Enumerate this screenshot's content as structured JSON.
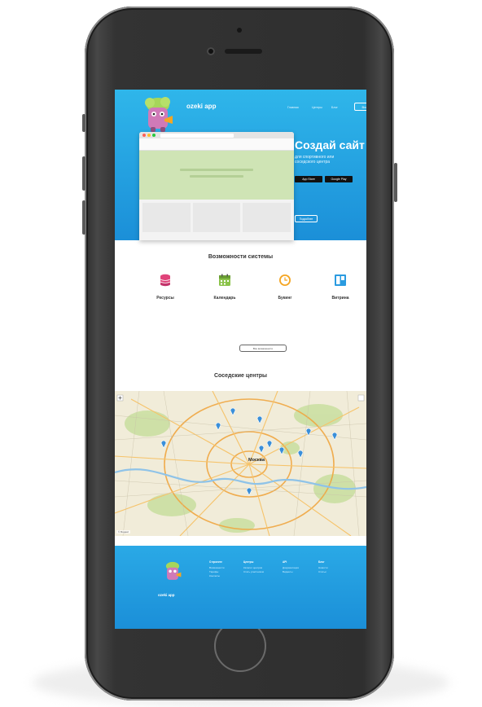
{
  "hero": {
    "brand": "ozeki app",
    "subtitle": "Создай сайт",
    "tagline": "для спортивного или\nсоседского центра",
    "store_buttons": [
      "App Store",
      "Google Play"
    ],
    "nav": [
      "Главная",
      "Центры",
      "Блог"
    ],
    "enter": "Вход",
    "more": "Подробнее"
  },
  "features": {
    "title": "Возможности системы",
    "items": [
      {
        "name": "Ресурсы",
        "icon": "database-icon",
        "color": "#e0447a"
      },
      {
        "name": "Календарь",
        "icon": "calendar-icon",
        "color": "#8bc34a"
      },
      {
        "name": "Букинг",
        "icon": "clock-icon",
        "color": "#f5a623"
      },
      {
        "name": "Витрина",
        "icon": "window-icon",
        "color": "#2a9be0"
      }
    ],
    "all_button": "Все возможности"
  },
  "map": {
    "title": "Соседские центры",
    "city": "Москва",
    "credit": "© Яндекс"
  },
  "footer": {
    "brand": "ozeki app",
    "columns": [
      {
        "heading": "О проекте",
        "items": [
          "Возможности",
          "Тарифы",
          "Контакты"
        ]
      },
      {
        "heading": "Центры",
        "items": [
          "Каталог центров",
          "Стать участником"
        ]
      },
      {
        "heading": "API",
        "items": [
          "Документация",
          "Виджеты"
        ]
      },
      {
        "heading": "Блог",
        "items": [
          "Новости",
          "Статьи"
        ]
      }
    ]
  }
}
